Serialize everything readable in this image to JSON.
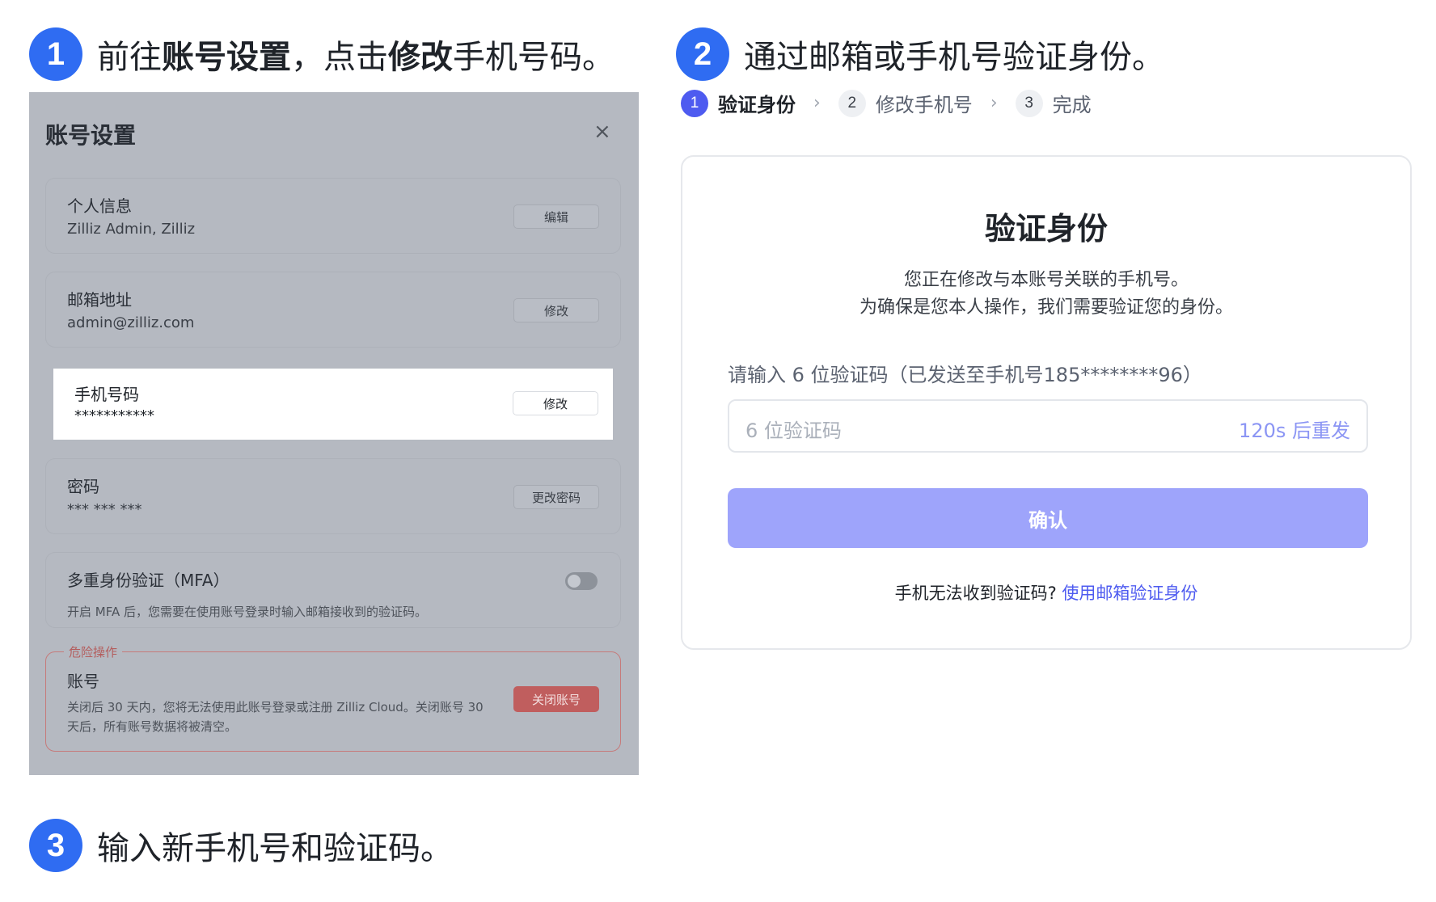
{
  "steps": [
    {
      "number": "1",
      "parts": [
        "前往",
        "账号设置",
        "，点击",
        "修改",
        "手机号码。"
      ]
    },
    {
      "number": "2",
      "text": "通过邮箱或手机号验证身份。"
    },
    {
      "number": "3",
      "text": "输入新手机号和验证码。"
    }
  ],
  "settings": {
    "title": "账号设置",
    "close": "×",
    "rows": [
      {
        "title": "个人信息",
        "value": "Zilliz Admin, Zilliz",
        "button": "编辑"
      },
      {
        "title": "邮箱地址",
        "value": "admin@zilliz.com",
        "button": "修改"
      },
      {
        "title": "手机号码",
        "value": "***********",
        "button": "修改"
      },
      {
        "title": "密码",
        "value": "*** *** ***",
        "button": "更改密码"
      }
    ],
    "mfa": {
      "title": "多重身份验证（MFA）",
      "desc": "开启 MFA 后，您需要在使用账号登录时输入邮箱接收到的验证码。",
      "enabled": false
    },
    "danger": {
      "legend": "危险操作",
      "title": "账号",
      "desc": "关闭后 30 天内，您将无法使用此账号登录或注册 Zilliz Cloud。关闭账号 30 天后，所有账号数据将被清空。",
      "button": "关闭账号"
    }
  },
  "stepper": [
    {
      "num": "1",
      "label": "验证身份",
      "active": true
    },
    {
      "num": "2",
      "label": "修改手机号",
      "active": false
    },
    {
      "num": "3",
      "label": "完成",
      "active": false
    }
  ],
  "stepper_separator": "›",
  "verify": {
    "title": "验证身份",
    "sub1": "您正在修改与本账号关联的手机号。",
    "sub2": "为确保是您本人操作，我们需要验证您的身份。",
    "field_label": "请输入 6 位验证码（已发送至手机号185********96）",
    "placeholder": "6 位验证码",
    "resend": "120s 后重发",
    "confirm": "确认",
    "help_text": "手机无法收到验证码?",
    "help_link": "使用邮箱验证身份"
  },
  "colors": {
    "step_badge": "#2f6cf2",
    "accent": "#4e5bf0",
    "confirm_bg": "#9ea4fb",
    "danger": "#c05e5e"
  }
}
